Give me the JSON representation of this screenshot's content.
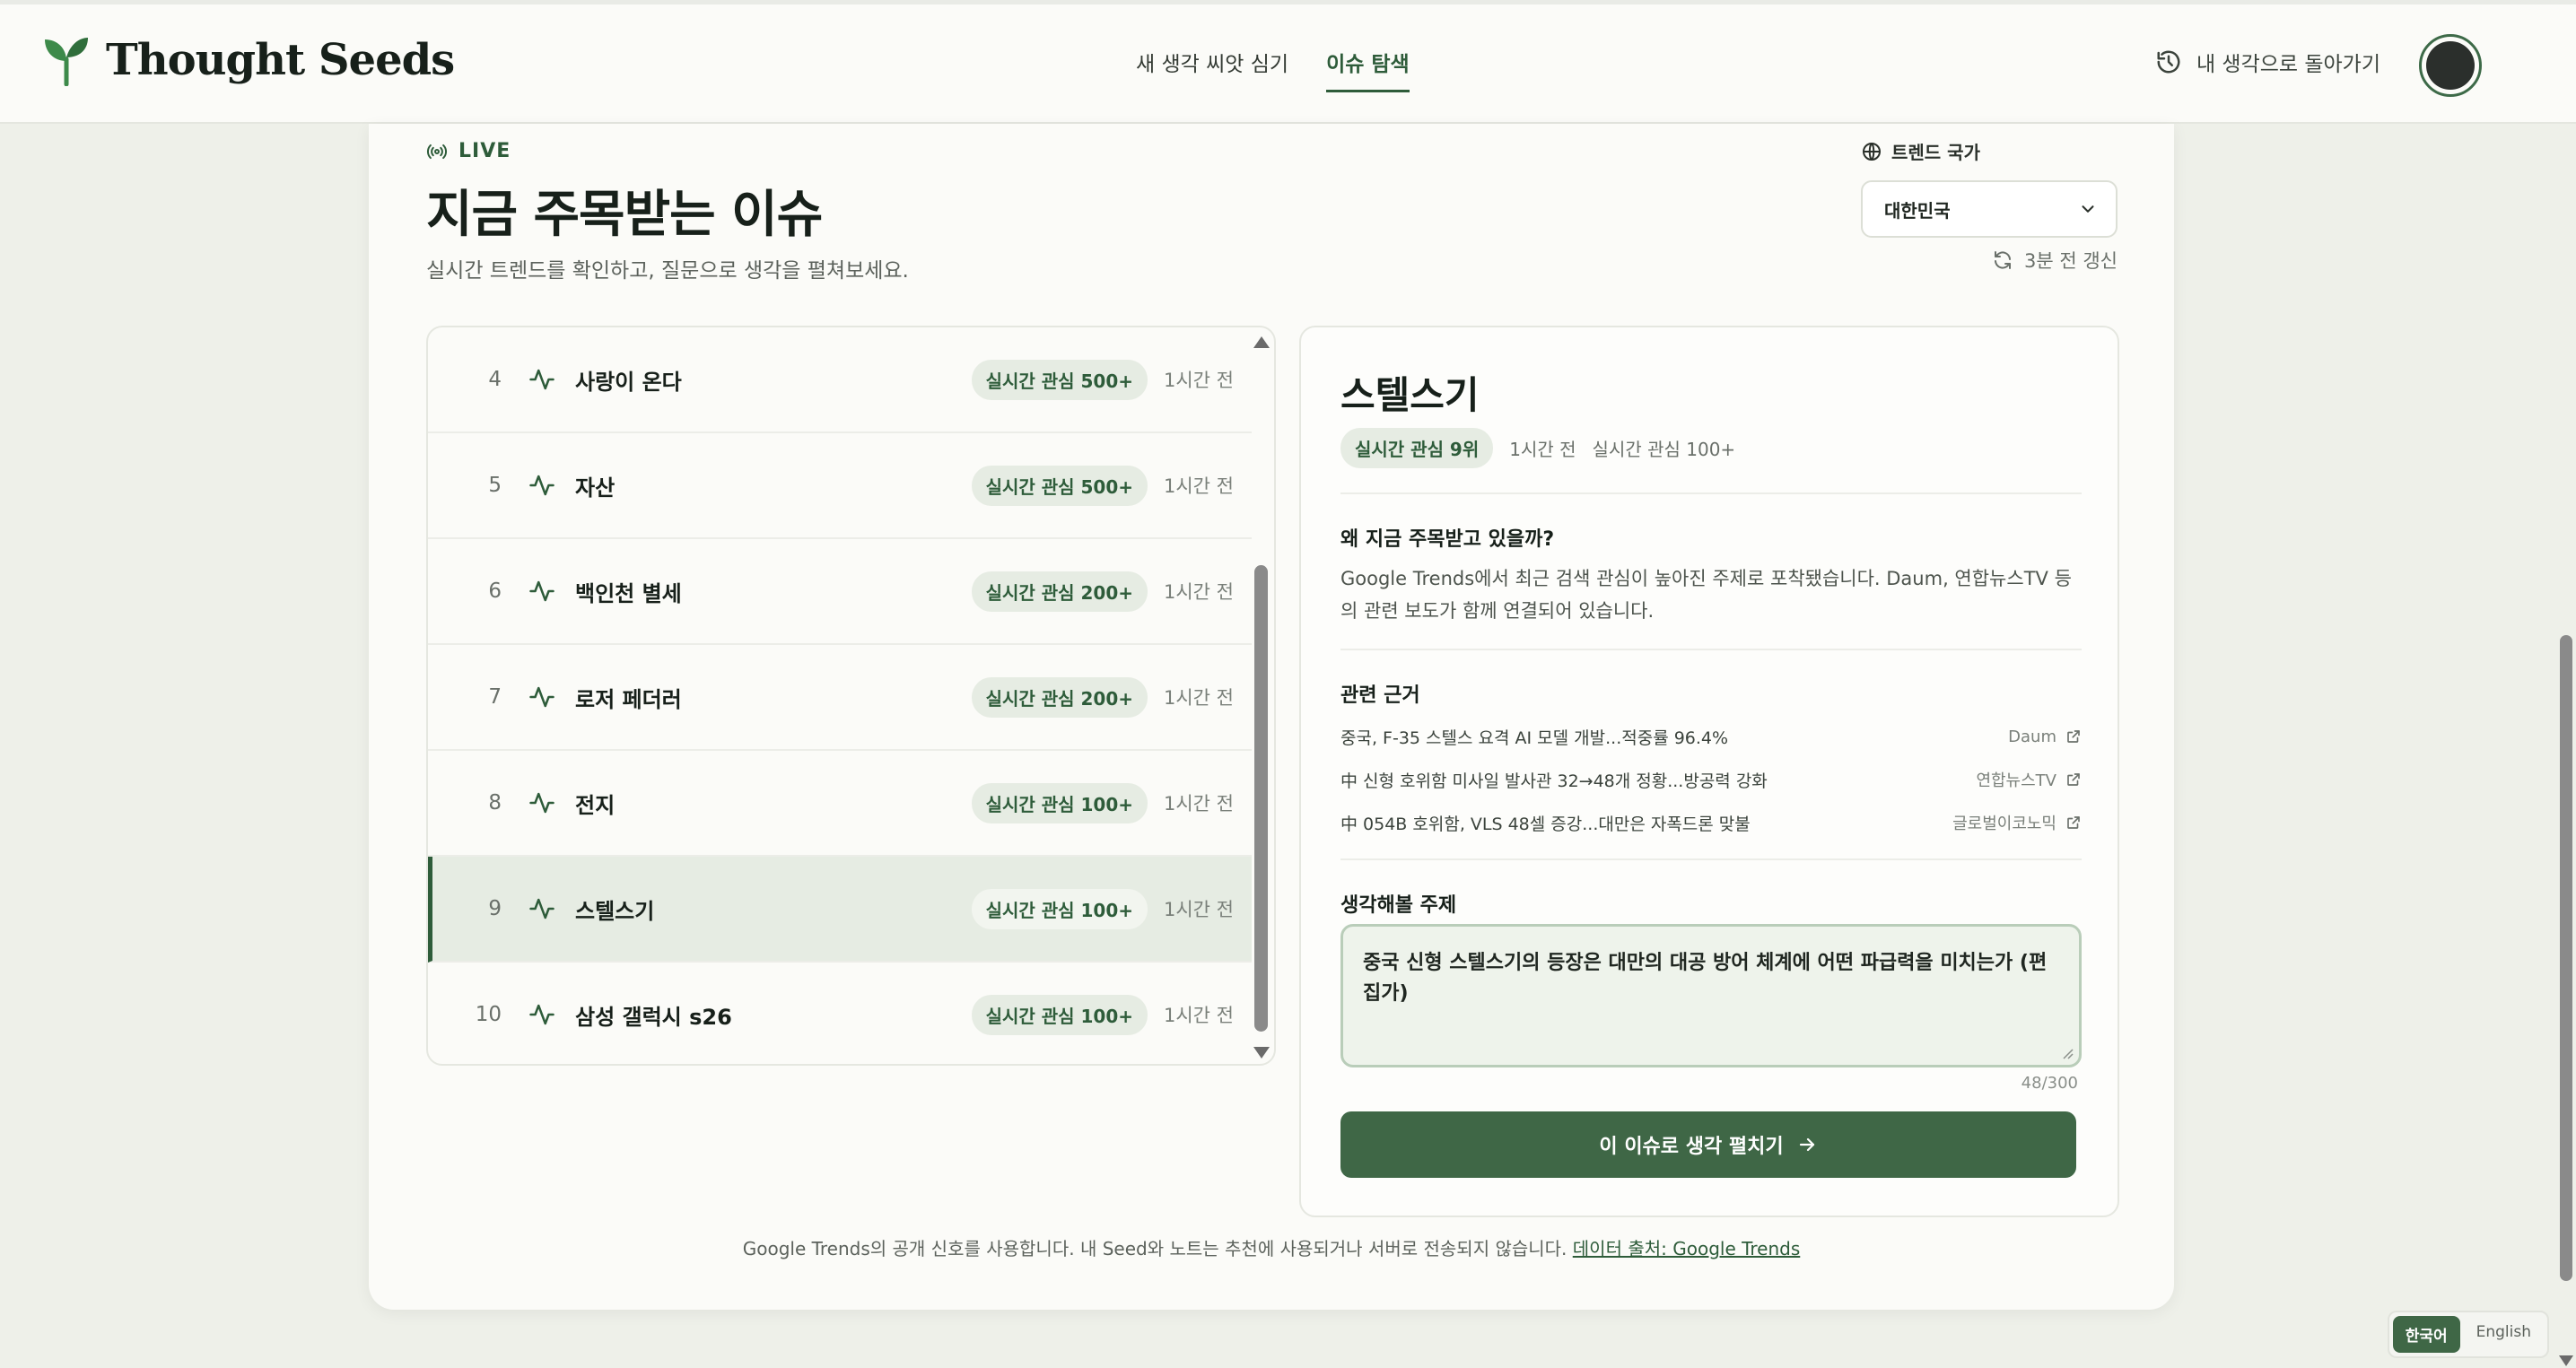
{
  "header": {
    "brand": "Thought Seeds",
    "nav": [
      {
        "label": "새 생각 씨앗 심기",
        "active": false
      },
      {
        "label": "이슈 탐색",
        "active": true
      }
    ],
    "back_label": "내 생각으로 돌아가기"
  },
  "hero": {
    "live": "LIVE",
    "title": "지금 주목받는 이슈",
    "subtitle": "실시간 트렌드를 확인하고, 질문으로 생각을 펼쳐보세요.",
    "country_label": "트렌드 국가",
    "country_value": "대한민국",
    "refresh": "3분 전 갱신"
  },
  "trends": [
    {
      "rank": "4",
      "title": "사랑이 온다",
      "badge": "실시간 관심 500+",
      "time": "1시간 전",
      "selected": false
    },
    {
      "rank": "5",
      "title": "자산",
      "badge": "실시간 관심 500+",
      "time": "1시간 전",
      "selected": false
    },
    {
      "rank": "6",
      "title": "백인천 별세",
      "badge": "실시간 관심 200+",
      "time": "1시간 전",
      "selected": false
    },
    {
      "rank": "7",
      "title": "로저 페더러",
      "badge": "실시간 관심 200+",
      "time": "1시간 전",
      "selected": false
    },
    {
      "rank": "8",
      "title": "전지",
      "badge": "실시간 관심 100+",
      "time": "1시간 전",
      "selected": false
    },
    {
      "rank": "9",
      "title": "스텔스기",
      "badge": "실시간 관심 100+",
      "time": "1시간 전",
      "selected": true
    },
    {
      "rank": "10",
      "title": "삼성 갤럭시 s26",
      "badge": "실시간 관심 100+",
      "time": "1시간 전",
      "selected": false
    }
  ],
  "detail": {
    "title": "스텔스기",
    "badge": "실시간 관심 9위",
    "time": "1시간 전",
    "interest": "실시간 관심 100+",
    "why_title": "왜 지금 주목받고 있을까?",
    "why_text": "Google Trends에서 최근 검색 관심이 높아진 주제로 포착됐습니다. Daum, 연합뉴스TV 등의 관련 보도가 함께 연결되어 있습니다.",
    "evidence_title": "관련 근거",
    "evidence": [
      {
        "headline": "중국, F-35 스텔스 요격 AI 모델 개발...적중률 96.4%",
        "source": "Daum"
      },
      {
        "headline": "中 신형 호위함 미사일 발사관 32→48개 정황...방공력 강화",
        "source": "연합뉴스TV"
      },
      {
        "headline": "中 054B 호위함, VLS 48셀 증강...대만은 자폭드론 맞불",
        "source": "글로벌이코노믹"
      }
    ],
    "topic_title": "생각해볼 주제",
    "topic_value": "중국 신형 스텔스기의 등장은 대만의 대공 방어 체계에 어떤 파급력을 미치는가 (편집가)",
    "counter": "48/300",
    "cta": "이 이슈로 생각 펼치기"
  },
  "footer": {
    "note": "Google Trends의 공개 신호를 사용합니다. 내 Seed와 노트는 추천에 사용되거나 서버로 전송되지 않습니다. ",
    "link": "데이터 출처: Google Trends"
  },
  "lang": {
    "active": "한국어",
    "inactive": "English"
  },
  "colors": {
    "accent": "#2e5c3a",
    "button": "#3f6746",
    "background": "#eef0e9"
  }
}
